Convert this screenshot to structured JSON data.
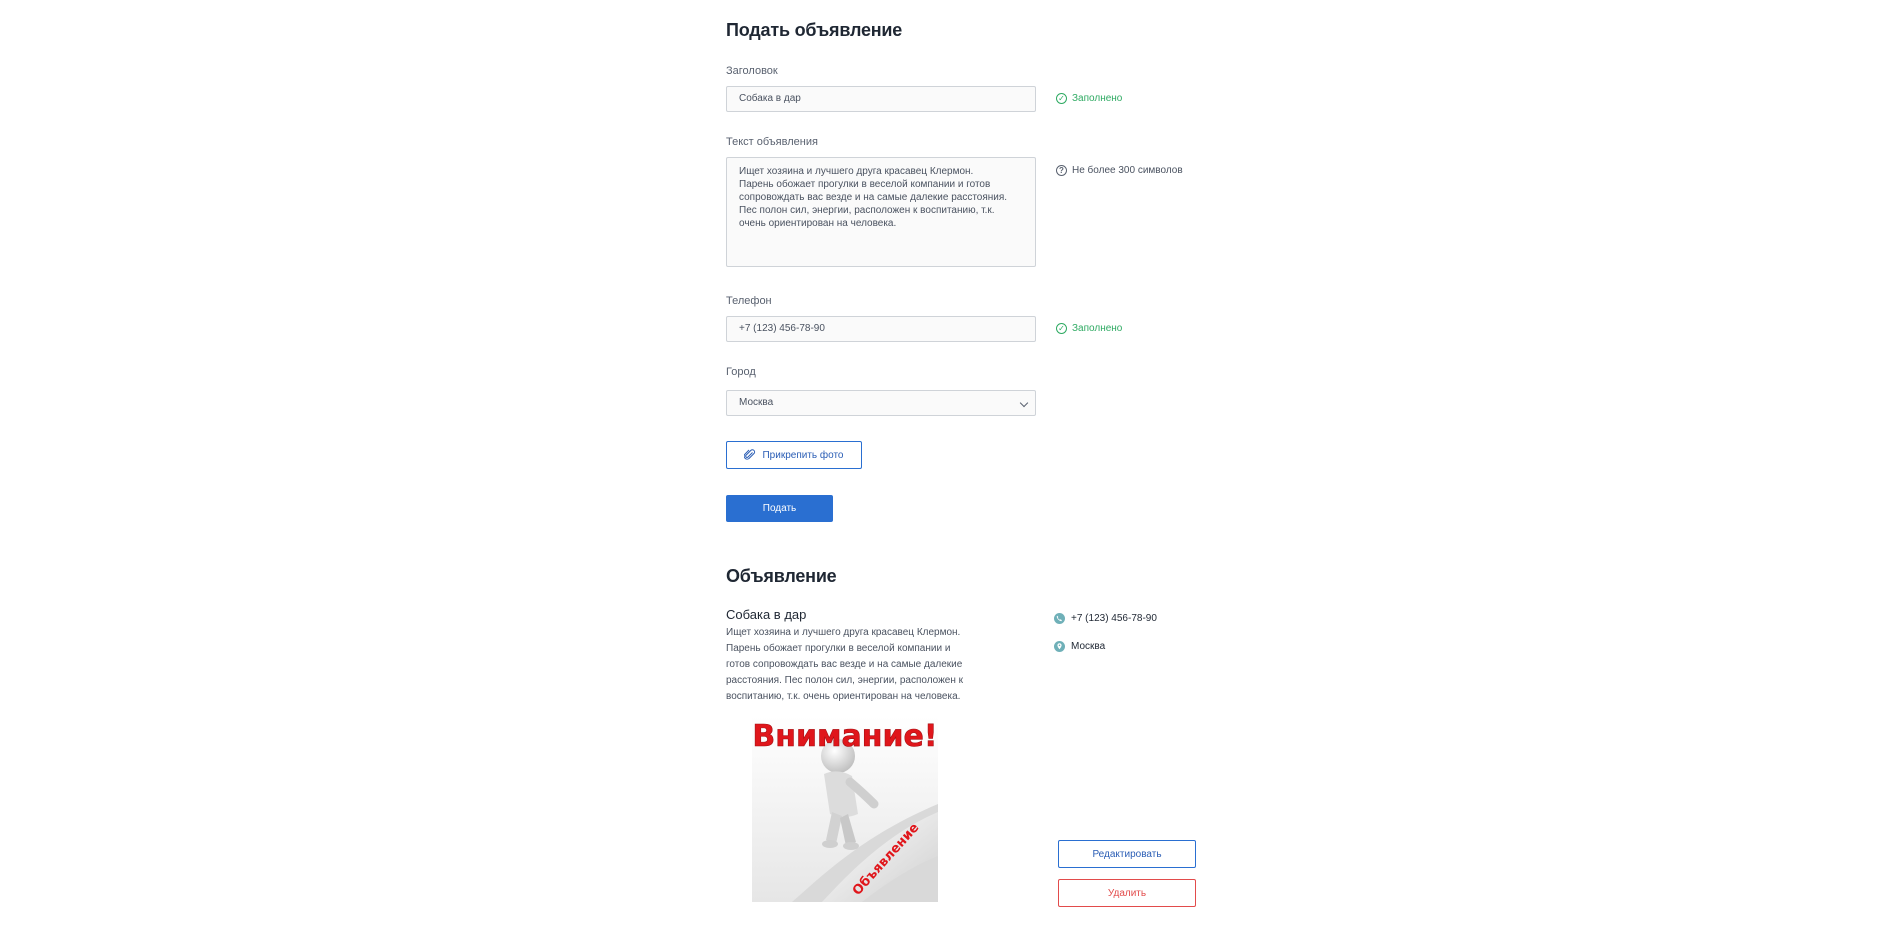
{
  "form": {
    "heading": "Подать объявление",
    "title_label": "Заголовок",
    "title_value": "Собака в дар",
    "title_status": "Заполнено",
    "text_label": "Текст объявления",
    "text_value": "Ищет хозяина и лучшего друга красавец Клермон.\nПарень обожает прогулки в веселой компании и готов сопровождать вас везде и на самые далекие расстояния. Пес полон сил, энергии, расположен к воспитанию, т.к. очень ориентирован на человека.",
    "text_hint": "Не более 300 символов",
    "phone_label": "Телефон",
    "phone_value": "+7 (123) 456-78-90",
    "phone_status": "Заполнено",
    "city_label": "Город",
    "city_value": "Москва",
    "attach_label": "Прикрепить фото",
    "submit_label": "Подать"
  },
  "ad": {
    "heading": "Объявление",
    "title": "Собака в дар",
    "text": "Ищет хозяина и лучшего друга красавец Клермон. Парень обожает прогулки в веселой компании и готов сопровождать вас везде и на самые далекие расстояния. Пес полон сил, энергии, расположен к воспитанию, т.к. очень ориентирован на человека.",
    "phone": "+7 (123) 456-78-90",
    "city": "Москва",
    "image_banner": "Внимание!",
    "image_page_text": "Объявление",
    "edit_label": "Редактировать",
    "delete_label": "Удалить"
  },
  "colors": {
    "accent": "#2a6fd1",
    "success": "#2eaa62",
    "danger": "#e24b4b",
    "banner_red": "#e0161b"
  },
  "icons": {
    "check": "check-circle-icon",
    "hint": "question-circle-icon",
    "chevron": "chevron-down-icon",
    "clip": "paperclip-icon",
    "phone": "phone-icon",
    "location": "location-pin-icon"
  }
}
